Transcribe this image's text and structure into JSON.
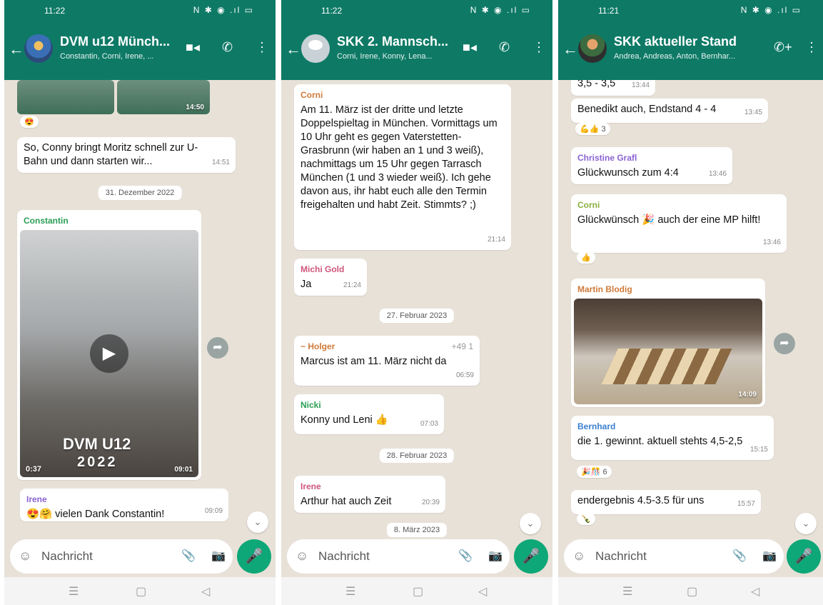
{
  "screens": [
    {
      "status": {
        "time": "11:22",
        "icons": "N ✱ ◉ .ıl ▭"
      },
      "header": {
        "title": "DVM u12 Münch...",
        "subtitle": "Constantin, Corni, Irene, ..."
      },
      "media1_time": "14:50",
      "reaction1": "😍",
      "msg1": {
        "text": "So, Conny bringt Moritz schnell zur U-Bahn und dann starten wir...",
        "time": "14:51"
      },
      "date_chip": "31. Dezember 2022",
      "video_msg": {
        "sender": "Constantin",
        "duration": "0:37",
        "caption_line1": "DVM U12",
        "caption_line2": "2022",
        "time": "09:01"
      },
      "msg2": {
        "sender": "Irene",
        "text": "😍🤗 vielen Dank Constantin!",
        "time": "09:09"
      },
      "input_placeholder": "Nachricht"
    },
    {
      "status": {
        "time": "11:22",
        "icons": "N ✱ ◉ .ıl ▭"
      },
      "header": {
        "title": "SKK 2. Mannsch...",
        "subtitle": "Corni, Irene, Konny, Lena..."
      },
      "msg1": {
        "sender": "Corni",
        "text": "Am 11. März ist der dritte und letzte Doppelspieltag in München. Vormittags um 10 Uhr geht es gegen Vaterstetten-Grasbrunn (wir haben an 1 und 3 weiß), nachmittags um 15 Uhr gegen Tarrasch München (1 und 3 wieder weiß). Ich gehe davon aus, ihr habt euch alle den Termin freigehalten und habt Zeit. Stimmts? ;)",
        "time": "21:14"
      },
      "msg2": {
        "sender": "Michi Gold",
        "text": "Ja",
        "time": "21:24"
      },
      "date1": "27. Februar 2023",
      "msg3": {
        "sender": "~ Holger",
        "phone": "+49 1",
        "text": "Marcus ist am 11. März nicht da",
        "time": "06:59"
      },
      "msg4": {
        "sender": "Nicki",
        "text": "Konny und Leni 👍",
        "time": "07:03"
      },
      "date2": "28. Februar 2023",
      "msg5": {
        "sender": "Irene",
        "text": "Arthur hat auch Zeit",
        "time": "20:39"
      },
      "date3": "8. März 2023",
      "input_placeholder": "Nachricht"
    },
    {
      "status": {
        "time": "11:21",
        "icons": "N ✱ ◉ .ıl ▭"
      },
      "header": {
        "title": "SKK aktueller Stand",
        "subtitle": "Andrea, Andreas, Anton, Bernhar..."
      },
      "msg0": {
        "text": "3,5 - 3,5",
        "time": "13:44"
      },
      "msg1": {
        "text": "Benedikt auch, Endstand 4 - 4",
        "time": "13:45"
      },
      "react1": "💪👍 3",
      "msg2": {
        "sender": "Christine Grafl",
        "text": "Glückwunsch zum 4:4",
        "time": "13:46"
      },
      "msg3": {
        "sender": "Corni",
        "text": "Glückwünsch 🎉 auch der eine MP hilft!",
        "time": "13:46"
      },
      "react3": "👍",
      "photo_msg": {
        "sender": "Martin Blodig",
        "time": "14:09"
      },
      "msg4": {
        "sender": "Bernhard",
        "text": "die 1. gewinnt. aktuell stehts 4,5-2,5",
        "time": "15:15"
      },
      "react4": "🎉🎊 6",
      "msg5": {
        "text": "endergebnis 4.5-3.5 für uns",
        "time": "15:57"
      },
      "react5": "🍾",
      "input_placeholder": "Nachricht"
    }
  ],
  "colors": {
    "header": "#0e7a66",
    "chat_bg": "#e8e1d8",
    "mic": "#0ea777",
    "sender_green": "#2a9d54",
    "sender_pink": "#d0567c",
    "sender_orange": "#d07a3a",
    "sender_purple": "#8a63d2",
    "sender_blue": "#3a7fd0"
  }
}
